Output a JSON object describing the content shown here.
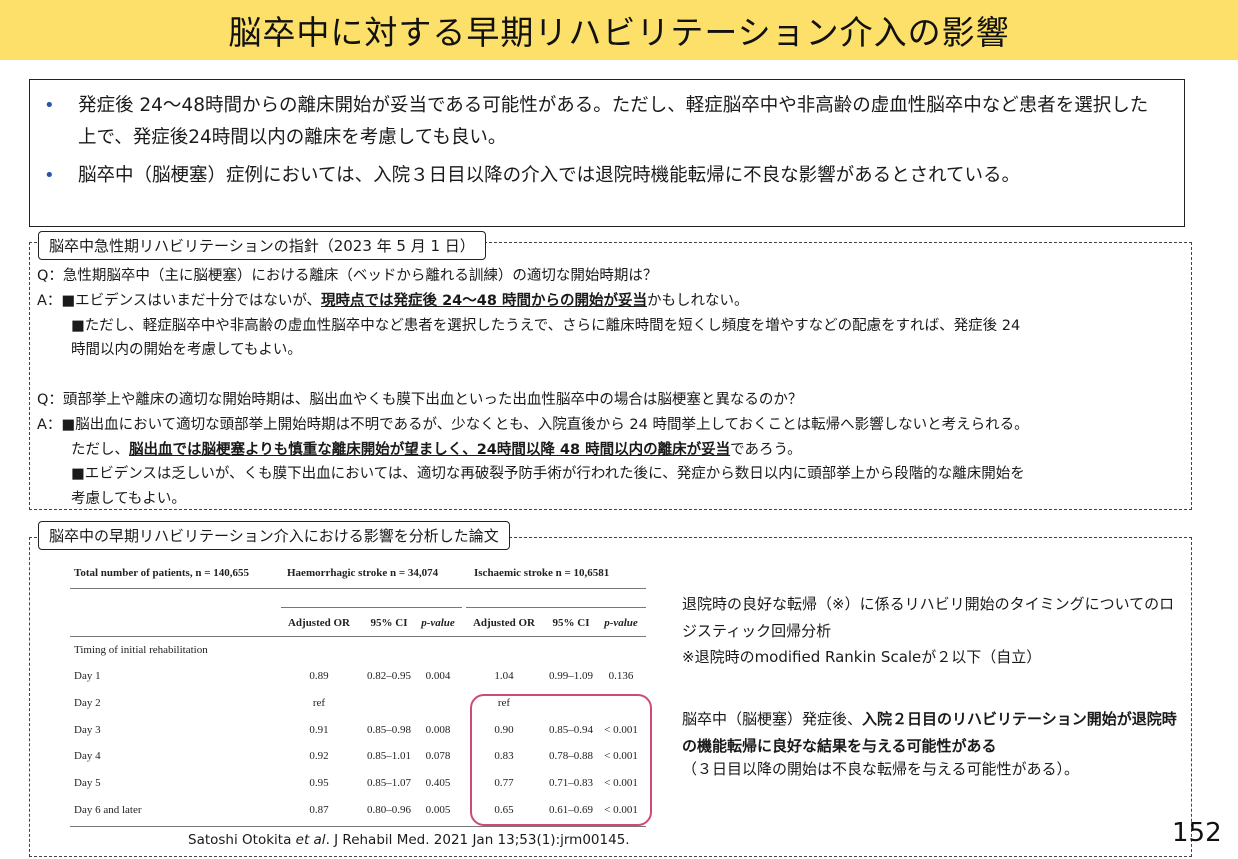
{
  "title": "脳卒中に対する早期リハビリテーション介入の影響",
  "summary": {
    "bullet_symbol": "•",
    "bullets": [
      "発症後 24～48時間からの離床開始が妥当である可能性がある。ただし、軽症脳卒中や非高齢の虚血性脳卒中など患者を選択した上で、発症後24時間以内の離床を考慮しても良い。",
      "脳卒中（脳梗塞）症例においては、入院３日目以降の介入では退院時機能転帰に不良な影響があるとされている。"
    ]
  },
  "guideline": {
    "label": "脳卒中急性期リハビリテーションの指針（2023 年 5 月 1 日）",
    "q1": "Q：急性期脳卒中（主に脳梗塞）における離床（ベッドから離れる訓練）の適切な開始時期は？",
    "a1_pre": "A：■エビデンスはいまだ十分ではないが、",
    "a1_bold": "現時点では発症後 24～48 時間からの開始が妥当",
    "a1_post": "かもしれない。",
    "a1_line2": "■ただし、軽症脳卒中や非高齢の虚血性脳卒中など患者を選択したうえで、さらに離床時間を短くし頻度を増やすなどの配慮をすれば、発症後 24",
    "a1_line3": "時間以内の開始を考慮してもよい。",
    "q2": "Q：頭部挙上や離床の適切な開始時期は、脳出血やくも膜下出血といった出血性脳卒中の場合は脳梗塞と異なるのか？",
    "a2_line1": "A：■脳出血において適切な頭部挙上開始時期は不明であるが、少なくとも、入院直後から 24 時間挙上しておくことは転帰へ影響しないと考えられる。",
    "a2_line2_pre": "ただし、",
    "a2_line2_bold": "脳出血では脳梗塞よりも慎重な離床開始が望ましく、24時間以降 48 時間以内の離床が妥当",
    "a2_line2_post": "であろう。",
    "a2_line3": "■エビデンスは乏しいが、くも膜下出血においては、適切な再破裂予防手術が行われた後に、発症から数日以内に頭部挙上から段階的な離床開始を",
    "a2_line4": "考慮してもよい。"
  },
  "paper": {
    "label": "脳卒中の早期リハビリテーション介入における影響を分析した論文",
    "table": {
      "total": "Total number of patients, n = 140,655",
      "group1": "Haemorrhagic stroke n = 34,074",
      "group2": "Ischaemic stroke n = 10,6581",
      "headers": [
        "Adjusted OR",
        "95% CI",
        "p-value",
        "Adjusted OR",
        "95% CI",
        "p-value"
      ],
      "section": "Timing of initial rehabilitation",
      "rows": [
        {
          "label": "Day 1",
          "cells": [
            "0.89",
            "0.82–0.95",
            "0.004",
            "1.04",
            "0.99–1.09",
            "0.136"
          ]
        },
        {
          "label": "Day 2",
          "cells": [
            "ref",
            "",
            "",
            "ref",
            "",
            ""
          ]
        },
        {
          "label": "Day 3",
          "cells": [
            "0.91",
            "0.85–0.98",
            "0.008",
            "0.90",
            "0.85–0.94",
            "< 0.001"
          ]
        },
        {
          "label": "Day 4",
          "cells": [
            "0.92",
            "0.85–1.01",
            "0.078",
            "0.83",
            "0.78–0.88",
            "< 0.001"
          ]
        },
        {
          "label": "Day 5",
          "cells": [
            "0.95",
            "0.85–1.07",
            "0.405",
            "0.77",
            "0.71–0.83",
            "< 0.001"
          ]
        },
        {
          "label": "Day 6 and later",
          "cells": [
            "0.87",
            "0.80–0.96",
            "0.005",
            "0.65",
            "0.61–0.69",
            "< 0.001"
          ]
        }
      ]
    },
    "citation_pre": "Satoshi Otokita ",
    "citation_italic": "et al",
    "citation_post": ". J Rehabil Med. 2021 Jan 13;53(1):jrm00145.",
    "right_text1": "退院時の良好な転帰（※）に係るリハビリ開始のタイミングについてのロジスティック回帰分析",
    "right_note": "※退院時のmodified Rankin Scaleが２以下（自立）",
    "right_text2_pre": "脳卒中（脳梗塞）発症後、",
    "right_text2_bold": "入院２日目のリハビリテーション開始が退院時の機能転帰に良好な結果を与える可能性がある",
    "right_text3": "（３日目以降の開始は不良な転帰を与える可能性がある）。"
  },
  "page_number": "152",
  "colors": {
    "title_background": "#fde06a",
    "bullet": "#2b56a8",
    "highlight_box": "#cc4d74"
  }
}
